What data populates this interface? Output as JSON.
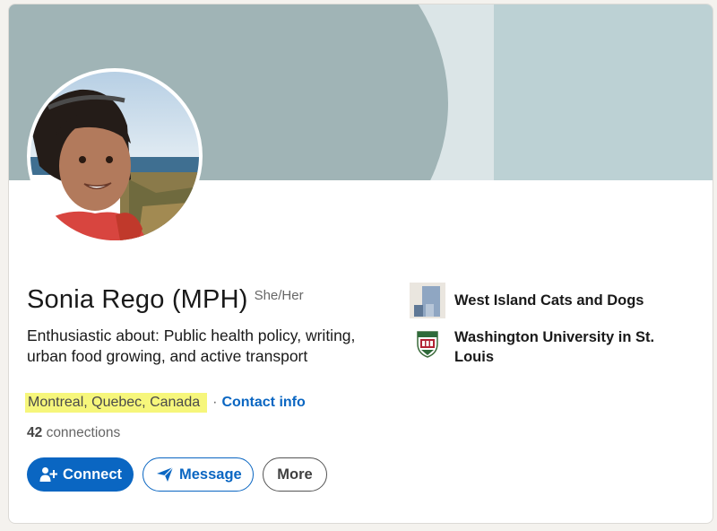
{
  "profile": {
    "name": "Sonia Rego (MPH)",
    "pronouns": "She/Her",
    "headline": "Enthusiastic about: Public health policy, writing, urban food growing, and active transport",
    "location": "Montreal, Quebec, Canada",
    "separator": "·",
    "contact_info_label": "Contact info",
    "connections_count": "42",
    "connections_label": "connections"
  },
  "actions": {
    "connect_label": "Connect",
    "message_label": "Message",
    "more_label": "More"
  },
  "sidebar": {
    "items": [
      {
        "label": "West Island Cats and Dogs",
        "icon": "company-logo-icon"
      },
      {
        "label": "Washington University in St. Louis",
        "icon": "university-crest-icon"
      }
    ]
  },
  "colors": {
    "accent": "#0a66c2",
    "location_highlight": "#f6f67b",
    "banner_light": "#dbe5e7",
    "banner_mid": "#bcd1d4",
    "banner_dark": "#a0b4b6"
  }
}
